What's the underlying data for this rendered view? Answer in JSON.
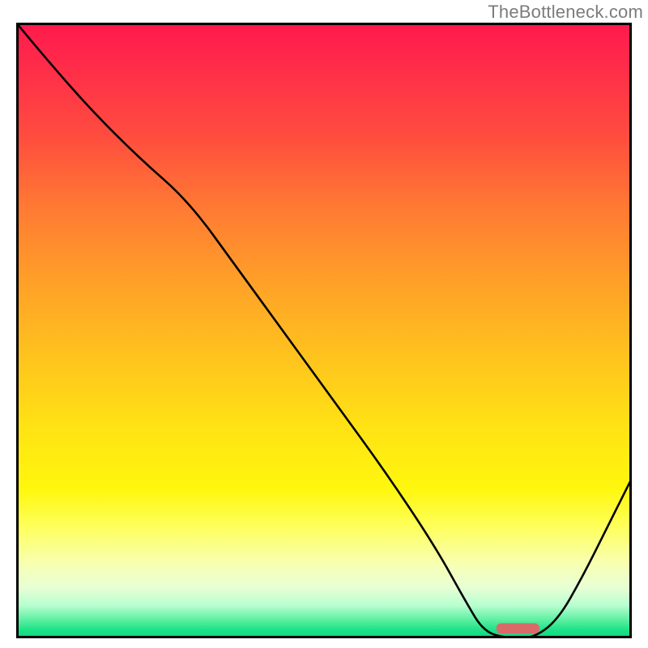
{
  "watermark": "TheBottleneck.com",
  "chart_data": {
    "type": "line",
    "title": "",
    "xlabel": "",
    "ylabel": "",
    "xlim": [
      0,
      100
    ],
    "ylim": [
      0,
      100
    ],
    "x": [
      0,
      5,
      12,
      20,
      28,
      36,
      44,
      52,
      60,
      68,
      73,
      76,
      80,
      84,
      88,
      92,
      96,
      100
    ],
    "values": [
      100,
      94,
      86,
      78,
      71,
      60,
      49,
      38,
      27,
      15,
      6,
      1,
      0,
      0,
      3,
      10,
      18,
      26
    ],
    "series": [
      {
        "name": "bottleneck-curve",
        "x": [
          0,
          5,
          12,
          20,
          28,
          36,
          44,
          52,
          60,
          68,
          73,
          76,
          80,
          84,
          88,
          92,
          96,
          100
        ],
        "values": [
          100,
          94,
          86,
          78,
          71,
          60,
          49,
          38,
          27,
          15,
          6,
          1,
          0,
          0,
          3,
          10,
          18,
          26
        ]
      }
    ],
    "optimum_range_x": [
      78,
      85
    ],
    "optimum_y": 1.6,
    "colors": {
      "gradient_top": "#ff1a4d",
      "gradient_mid": "#ffe314",
      "gradient_bottom": "#11d980",
      "curve": "#000000",
      "optimum_bar": "#da6a6a",
      "border": "#000000",
      "watermark": "#7c7c7c"
    }
  }
}
